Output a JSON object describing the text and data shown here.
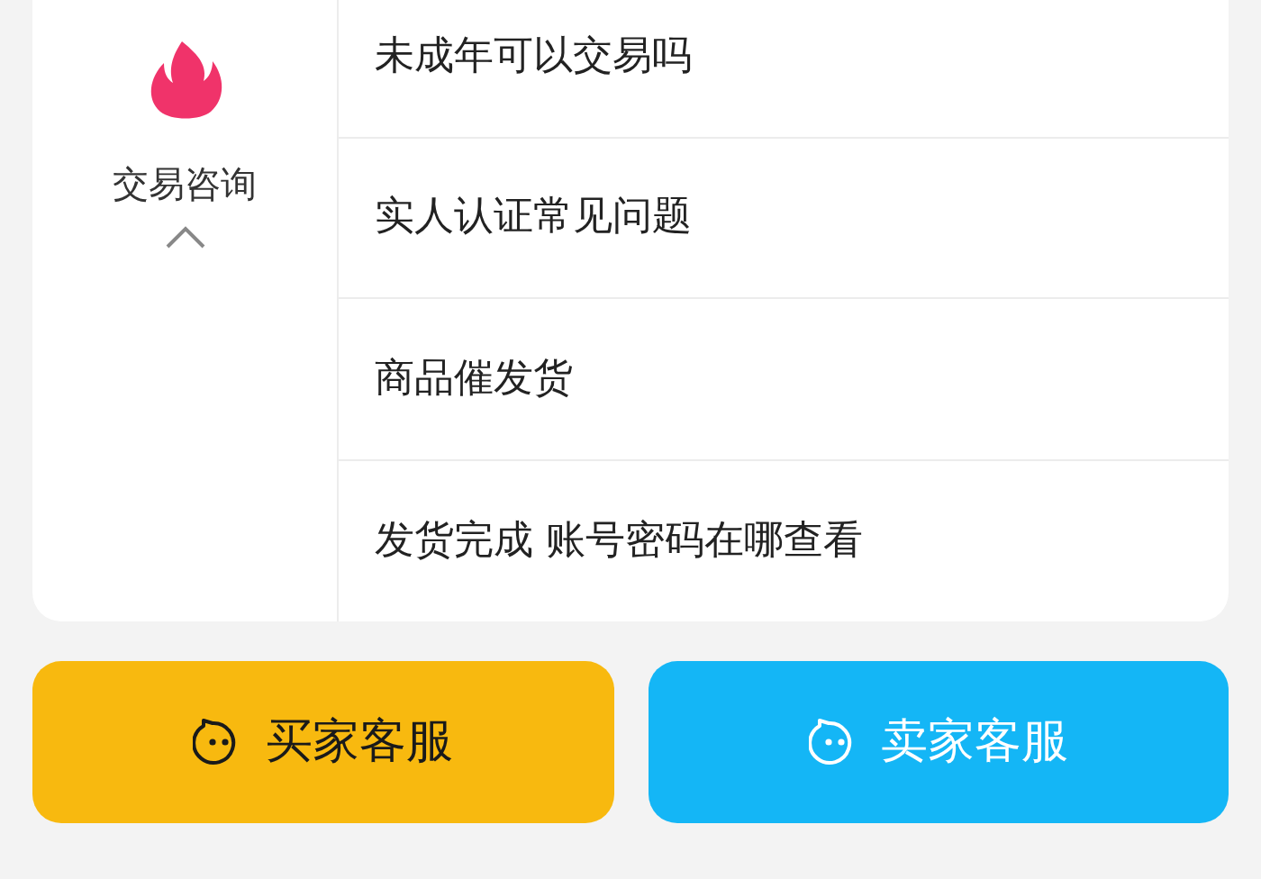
{
  "category": {
    "label": "交易咨询",
    "expanded": true
  },
  "questions": [
    "未成年可以交易吗",
    "实人认证常见问题",
    "商品催发货",
    "发货完成 账号密码在哪查看"
  ],
  "buttons": [
    {
      "label": "买家客服",
      "kind": "buyer"
    },
    {
      "label": "卖家客服",
      "kind": "seller"
    }
  ]
}
